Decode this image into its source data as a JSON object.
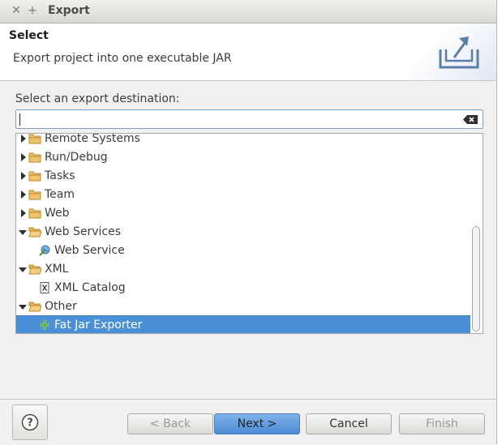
{
  "window": {
    "title": "Export"
  },
  "banner": {
    "title": "Select",
    "description": "Export project into one executable JAR"
  },
  "destination": {
    "label": "Select an export destination:",
    "filter_value": ""
  },
  "tree": {
    "items": [
      {
        "label": "Remote Systems",
        "expanded": false,
        "icon": "folder-icon",
        "selected": false
      },
      {
        "label": "Run/Debug",
        "expanded": false,
        "icon": "folder-icon",
        "selected": false
      },
      {
        "label": "Tasks",
        "expanded": false,
        "icon": "folder-icon",
        "selected": false
      },
      {
        "label": "Team",
        "expanded": false,
        "icon": "folder-icon",
        "selected": false
      },
      {
        "label": "Web",
        "expanded": false,
        "icon": "folder-icon",
        "selected": false
      },
      {
        "label": "Web Services",
        "expanded": true,
        "icon": "folder-open-icon",
        "selected": false
      },
      {
        "label": "Web Service",
        "icon": "web-service-icon",
        "selected": false
      },
      {
        "label": "XML",
        "expanded": true,
        "icon": "folder-open-icon",
        "selected": false
      },
      {
        "label": "XML Catalog",
        "icon": "xml-catalog-icon",
        "selected": false
      },
      {
        "label": "Other",
        "expanded": true,
        "icon": "folder-open-icon",
        "selected": false
      },
      {
        "label": "Fat Jar Exporter",
        "icon": "fat-jar-icon",
        "selected": true
      }
    ]
  },
  "buttons": {
    "help": "?",
    "back": "< Back",
    "next": "Next >",
    "cancel": "Cancel",
    "finish": "Finish"
  },
  "colors": {
    "selection": "#4a90d9",
    "folder": "#e8b651"
  }
}
